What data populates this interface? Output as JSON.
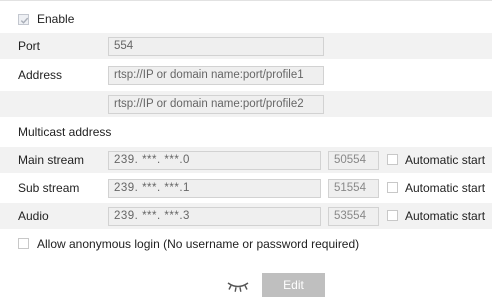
{
  "enable": {
    "label": "Enable",
    "checked": true
  },
  "port": {
    "label": "Port",
    "value": "554"
  },
  "address": {
    "label": "Address",
    "value1": "rtsp://IP or domain name:port/profile1",
    "value2": "rtsp://IP or domain name:port/profile2"
  },
  "multicast": {
    "heading": "Multicast address",
    "streams": [
      {
        "label": "Main stream",
        "ip": "239.  ***.  ***.0",
        "port": "50554",
        "auto_label": "Automatic start"
      },
      {
        "label": "Sub stream",
        "ip": "239.  ***.  ***.1",
        "port": "51554",
        "auto_label": "Automatic start"
      },
      {
        "label": "Audio",
        "ip": "239.  ***.  ***.3",
        "port": "53554",
        "auto_label": "Automatic start"
      }
    ]
  },
  "anonymous": {
    "label": "Allow anonymous login (No username or password required)",
    "checked": false
  },
  "footer": {
    "edit_label": "Edit",
    "icon": "eye-closed-icon"
  },
  "colors": {
    "shade": "#f2f2f2",
    "field_bg": "#efefef",
    "button_bg": "#bfbfbf"
  }
}
